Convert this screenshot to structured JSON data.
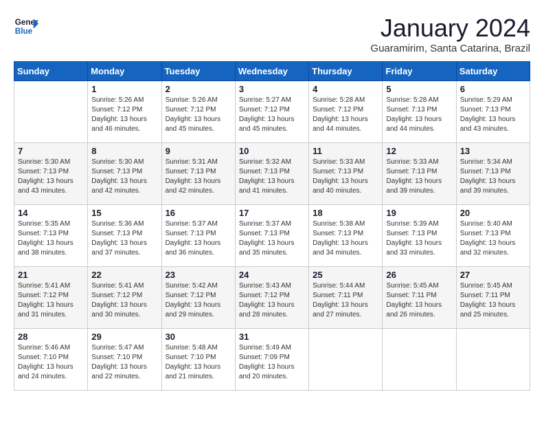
{
  "header": {
    "logo_line1": "General",
    "logo_line2": "Blue",
    "title": "January 2024",
    "subtitle": "Guaramirim, Santa Catarina, Brazil"
  },
  "weekdays": [
    "Sunday",
    "Monday",
    "Tuesday",
    "Wednesday",
    "Thursday",
    "Friday",
    "Saturday"
  ],
  "weeks": [
    [
      {
        "day": "",
        "info": ""
      },
      {
        "day": "1",
        "info": "Sunrise: 5:26 AM\nSunset: 7:12 PM\nDaylight: 13 hours\nand 46 minutes."
      },
      {
        "day": "2",
        "info": "Sunrise: 5:26 AM\nSunset: 7:12 PM\nDaylight: 13 hours\nand 45 minutes."
      },
      {
        "day": "3",
        "info": "Sunrise: 5:27 AM\nSunset: 7:12 PM\nDaylight: 13 hours\nand 45 minutes."
      },
      {
        "day": "4",
        "info": "Sunrise: 5:28 AM\nSunset: 7:12 PM\nDaylight: 13 hours\nand 44 minutes."
      },
      {
        "day": "5",
        "info": "Sunrise: 5:28 AM\nSunset: 7:13 PM\nDaylight: 13 hours\nand 44 minutes."
      },
      {
        "day": "6",
        "info": "Sunrise: 5:29 AM\nSunset: 7:13 PM\nDaylight: 13 hours\nand 43 minutes."
      }
    ],
    [
      {
        "day": "7",
        "info": "Sunrise: 5:30 AM\nSunset: 7:13 PM\nDaylight: 13 hours\nand 43 minutes."
      },
      {
        "day": "8",
        "info": "Sunrise: 5:30 AM\nSunset: 7:13 PM\nDaylight: 13 hours\nand 42 minutes."
      },
      {
        "day": "9",
        "info": "Sunrise: 5:31 AM\nSunset: 7:13 PM\nDaylight: 13 hours\nand 42 minutes."
      },
      {
        "day": "10",
        "info": "Sunrise: 5:32 AM\nSunset: 7:13 PM\nDaylight: 13 hours\nand 41 minutes."
      },
      {
        "day": "11",
        "info": "Sunrise: 5:33 AM\nSunset: 7:13 PM\nDaylight: 13 hours\nand 40 minutes."
      },
      {
        "day": "12",
        "info": "Sunrise: 5:33 AM\nSunset: 7:13 PM\nDaylight: 13 hours\nand 39 minutes."
      },
      {
        "day": "13",
        "info": "Sunrise: 5:34 AM\nSunset: 7:13 PM\nDaylight: 13 hours\nand 39 minutes."
      }
    ],
    [
      {
        "day": "14",
        "info": "Sunrise: 5:35 AM\nSunset: 7:13 PM\nDaylight: 13 hours\nand 38 minutes."
      },
      {
        "day": "15",
        "info": "Sunrise: 5:36 AM\nSunset: 7:13 PM\nDaylight: 13 hours\nand 37 minutes."
      },
      {
        "day": "16",
        "info": "Sunrise: 5:37 AM\nSunset: 7:13 PM\nDaylight: 13 hours\nand 36 minutes."
      },
      {
        "day": "17",
        "info": "Sunrise: 5:37 AM\nSunset: 7:13 PM\nDaylight: 13 hours\nand 35 minutes."
      },
      {
        "day": "18",
        "info": "Sunrise: 5:38 AM\nSunset: 7:13 PM\nDaylight: 13 hours\nand 34 minutes."
      },
      {
        "day": "19",
        "info": "Sunrise: 5:39 AM\nSunset: 7:13 PM\nDaylight: 13 hours\nand 33 minutes."
      },
      {
        "day": "20",
        "info": "Sunrise: 5:40 AM\nSunset: 7:13 PM\nDaylight: 13 hours\nand 32 minutes."
      }
    ],
    [
      {
        "day": "21",
        "info": "Sunrise: 5:41 AM\nSunset: 7:12 PM\nDaylight: 13 hours\nand 31 minutes."
      },
      {
        "day": "22",
        "info": "Sunrise: 5:41 AM\nSunset: 7:12 PM\nDaylight: 13 hours\nand 30 minutes."
      },
      {
        "day": "23",
        "info": "Sunrise: 5:42 AM\nSunset: 7:12 PM\nDaylight: 13 hours\nand 29 minutes."
      },
      {
        "day": "24",
        "info": "Sunrise: 5:43 AM\nSunset: 7:12 PM\nDaylight: 13 hours\nand 28 minutes."
      },
      {
        "day": "25",
        "info": "Sunrise: 5:44 AM\nSunset: 7:11 PM\nDaylight: 13 hours\nand 27 minutes."
      },
      {
        "day": "26",
        "info": "Sunrise: 5:45 AM\nSunset: 7:11 PM\nDaylight: 13 hours\nand 26 minutes."
      },
      {
        "day": "27",
        "info": "Sunrise: 5:45 AM\nSunset: 7:11 PM\nDaylight: 13 hours\nand 25 minutes."
      }
    ],
    [
      {
        "day": "28",
        "info": "Sunrise: 5:46 AM\nSunset: 7:10 PM\nDaylight: 13 hours\nand 24 minutes."
      },
      {
        "day": "29",
        "info": "Sunrise: 5:47 AM\nSunset: 7:10 PM\nDaylight: 13 hours\nand 22 minutes."
      },
      {
        "day": "30",
        "info": "Sunrise: 5:48 AM\nSunset: 7:10 PM\nDaylight: 13 hours\nand 21 minutes."
      },
      {
        "day": "31",
        "info": "Sunrise: 5:49 AM\nSunset: 7:09 PM\nDaylight: 13 hours\nand 20 minutes."
      },
      {
        "day": "",
        "info": ""
      },
      {
        "day": "",
        "info": ""
      },
      {
        "day": "",
        "info": ""
      }
    ]
  ]
}
